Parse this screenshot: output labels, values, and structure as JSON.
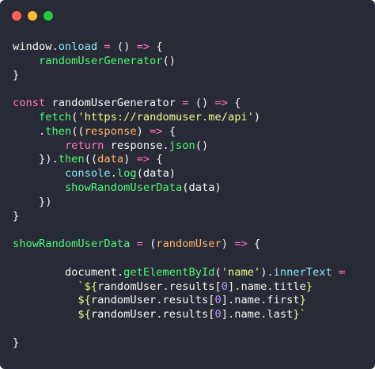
{
  "window_controls": {
    "close_color": "#ff5f56",
    "minimize_color": "#ffbd2e",
    "zoom_color": "#27c93f"
  },
  "colors": {
    "background": "#282a36",
    "default": "#f8f8f2",
    "keyword": "#ff79c6",
    "function": "#50fa7b",
    "string": "#f1fa8c",
    "property": "#8be9fd",
    "parameter": "#ffb86c",
    "number": "#bd93f9"
  },
  "code_lines": [
    {
      "indent": 0,
      "tokens": [
        [
          "default",
          "window."
        ],
        [
          "property",
          "onload"
        ],
        [
          "keyword",
          " = "
        ],
        [
          "default",
          "() "
        ],
        [
          "keyword",
          "=>"
        ],
        [
          "default",
          " {"
        ]
      ]
    },
    {
      "indent": 4,
      "tokens": [
        [
          "function",
          "randomUserGenerator"
        ],
        [
          "default",
          "()"
        ]
      ]
    },
    {
      "indent": 0,
      "tokens": [
        [
          "default",
          "}"
        ]
      ]
    },
    {
      "indent": 0,
      "tokens": []
    },
    {
      "indent": 0,
      "tokens": [
        [
          "keyword",
          "const "
        ],
        [
          "default",
          "randomUserGenerator"
        ],
        [
          "keyword",
          " = "
        ],
        [
          "default",
          "() "
        ],
        [
          "keyword",
          "=>"
        ],
        [
          "default",
          " {"
        ]
      ]
    },
    {
      "indent": 4,
      "tokens": [
        [
          "function",
          "fetch"
        ],
        [
          "default",
          "("
        ],
        [
          "string",
          "'https://randomuser.me/api'"
        ],
        [
          "default",
          ")"
        ]
      ]
    },
    {
      "indent": 4,
      "tokens": [
        [
          "default",
          "."
        ],
        [
          "function",
          "then"
        ],
        [
          "default",
          "(("
        ],
        [
          "parameter",
          "response"
        ],
        [
          "default",
          ") "
        ],
        [
          "keyword",
          "=>"
        ],
        [
          "default",
          " {"
        ]
      ]
    },
    {
      "indent": 8,
      "tokens": [
        [
          "keyword",
          "return "
        ],
        [
          "default",
          "response."
        ],
        [
          "function",
          "json"
        ],
        [
          "default",
          "()"
        ]
      ]
    },
    {
      "indent": 4,
      "tokens": [
        [
          "default",
          "})."
        ],
        [
          "function",
          "then"
        ],
        [
          "default",
          "(("
        ],
        [
          "parameter",
          "data"
        ],
        [
          "default",
          ") "
        ],
        [
          "keyword",
          "=>"
        ],
        [
          "default",
          " {"
        ]
      ]
    },
    {
      "indent": 8,
      "tokens": [
        [
          "property",
          "console"
        ],
        [
          "default",
          "."
        ],
        [
          "function",
          "log"
        ],
        [
          "default",
          "(data)"
        ]
      ]
    },
    {
      "indent": 8,
      "tokens": [
        [
          "function",
          "showRandomUserData"
        ],
        [
          "default",
          "(data)"
        ]
      ]
    },
    {
      "indent": 4,
      "tokens": [
        [
          "default",
          "})"
        ]
      ]
    },
    {
      "indent": 0,
      "tokens": [
        [
          "default",
          "}"
        ]
      ]
    },
    {
      "indent": 0,
      "tokens": []
    },
    {
      "indent": 0,
      "tokens": [
        [
          "function",
          "showRandomUserData"
        ],
        [
          "keyword",
          " = "
        ],
        [
          "default",
          "("
        ],
        [
          "parameter",
          "randomUser"
        ],
        [
          "default",
          ") "
        ],
        [
          "keyword",
          "=>"
        ],
        [
          "default",
          " {"
        ]
      ]
    },
    {
      "indent": 0,
      "tokens": []
    },
    {
      "indent": 8,
      "tokens": [
        [
          "default",
          "document."
        ],
        [
          "function",
          "getElementById"
        ],
        [
          "default",
          "("
        ],
        [
          "string",
          "'name'"
        ],
        [
          "default",
          ")."
        ],
        [
          "property",
          "innerText"
        ],
        [
          "keyword",
          " ="
        ]
      ]
    },
    {
      "indent": 10,
      "tokens": [
        [
          "string",
          "`${"
        ],
        [
          "default",
          "randomUser.results["
        ],
        [
          "number",
          "0"
        ],
        [
          "default",
          "].name.title"
        ],
        [
          "string",
          "}"
        ]
      ]
    },
    {
      "indent": 10,
      "tokens": [
        [
          "string",
          "${"
        ],
        [
          "default",
          "randomUser.results["
        ],
        [
          "number",
          "0"
        ],
        [
          "default",
          "].name.first"
        ],
        [
          "string",
          "}"
        ]
      ]
    },
    {
      "indent": 10,
      "tokens": [
        [
          "string",
          "${"
        ],
        [
          "default",
          "randomUser.results["
        ],
        [
          "number",
          "0"
        ],
        [
          "default",
          "].name.last"
        ],
        [
          "string",
          "}`"
        ]
      ]
    },
    {
      "indent": 0,
      "tokens": []
    },
    {
      "indent": 0,
      "tokens": [
        [
          "default",
          "}"
        ]
      ]
    }
  ]
}
